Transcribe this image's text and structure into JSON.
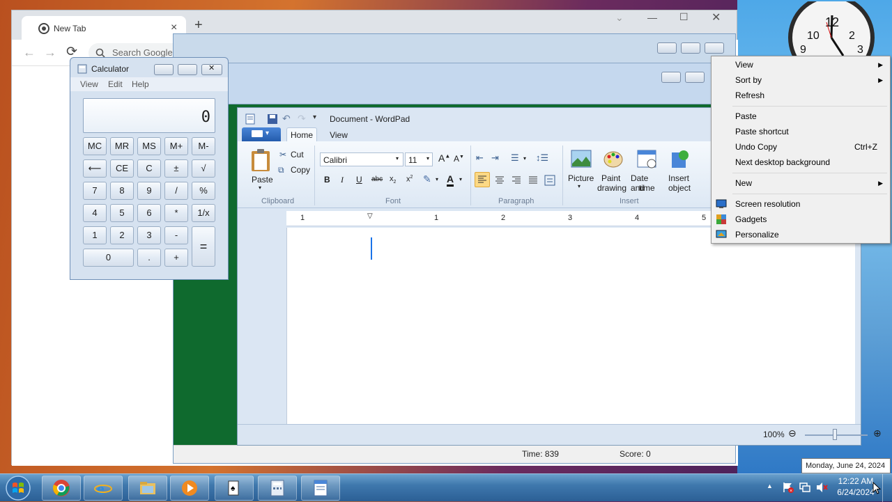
{
  "chrome": {
    "tab_title": "New Tab",
    "tab_close": "×",
    "new_tab": "+",
    "omnibox_placeholder": "Search Google",
    "back": "←",
    "forward": "→",
    "reload": "⟳"
  },
  "calculator": {
    "title": "Calculator",
    "menu": [
      "View",
      "Edit",
      "Help"
    ],
    "display": "0",
    "buttons": {
      "mc": "MC",
      "mr": "MR",
      "ms": "MS",
      "mplus": "M+",
      "mminus": "M-",
      "back": "⟵",
      "ce": "CE",
      "c": "C",
      "pm": "±",
      "sqrt": "√",
      "n7": "7",
      "n8": "8",
      "n9": "9",
      "div": "/",
      "pct": "%",
      "n4": "4",
      "n5": "5",
      "n6": "6",
      "mul": "*",
      "inv": "1/x",
      "n1": "1",
      "n2": "2",
      "n3": "3",
      "sub": "-",
      "eq": "=",
      "n0": "0",
      "dot": ".",
      "add": "+"
    }
  },
  "wordpad": {
    "title": "Document - WordPad",
    "tabs": [
      "Home",
      "View"
    ],
    "clipboard": {
      "group": "Clipboard",
      "paste": "Paste",
      "cut": "Cut",
      "copy": "Copy"
    },
    "font": {
      "group": "Font",
      "family": "Calibri",
      "size": "11"
    },
    "paragraph": {
      "group": "Paragraph"
    },
    "insert": {
      "group": "Insert",
      "picture": "Picture",
      "paint1": "Paint",
      "paint2": "drawing",
      "date1": "Date and",
      "date2": "time",
      "obj1": "Insert",
      "obj2": "object"
    },
    "ruler_numbers": [
      "1",
      "1",
      "2",
      "3",
      "4",
      "5"
    ],
    "zoom": "100%"
  },
  "solitaire": {
    "time": "Time:  839",
    "score": "Score: 0"
  },
  "context_menu": {
    "view": "View",
    "sort_by": "Sort by",
    "refresh": "Refresh",
    "paste": "Paste",
    "paste_shortcut": "Paste shortcut",
    "undo_copy": "Undo Copy",
    "undo_shortcut": "Ctrl+Z",
    "next_bg": "Next desktop background",
    "new": "New",
    "screen_res": "Screen resolution",
    "gadgets": "Gadgets",
    "personalize": "Personalize"
  },
  "tooltip": "Monday, June 24, 2024",
  "taskbar": {
    "time": "12:22 AM",
    "date": "6/24/2024",
    "show_hidden": "▲"
  },
  "clock_numbers": [
    "10",
    "12",
    "2",
    "9",
    "3"
  ],
  "colors": {
    "taskbar": "#3f78ad",
    "felt": "#0f6a2e",
    "wordpad_file_btn": "#2a63b8"
  }
}
